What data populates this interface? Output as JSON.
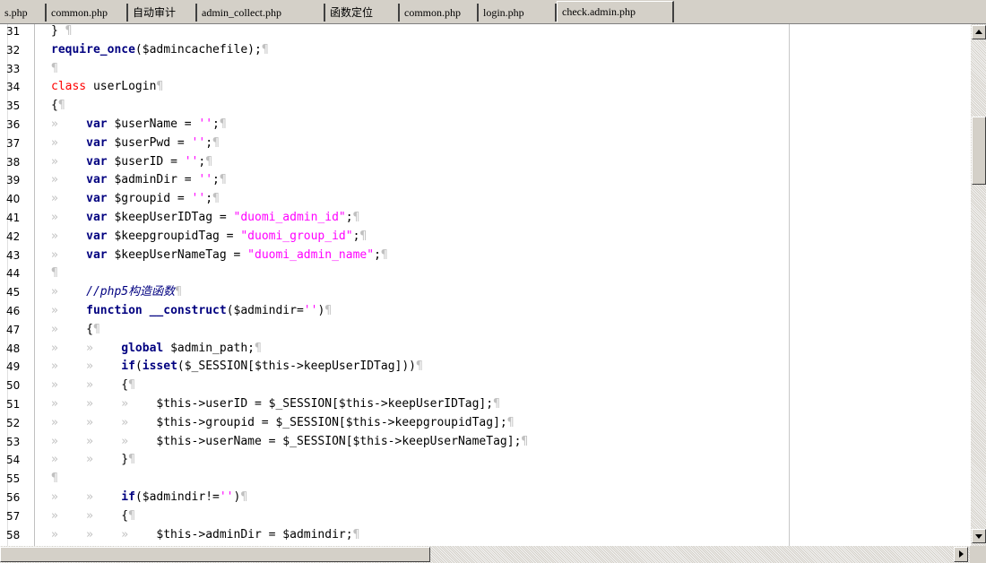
{
  "tabs": [
    {
      "label": "s.php",
      "active": false
    },
    {
      "label": "common.php",
      "active": false
    },
    {
      "label": "自动审计",
      "active": false
    },
    {
      "label": "admin_collect.php",
      "active": false
    },
    {
      "label": "函数定位",
      "active": false
    },
    {
      "label": "common.php",
      "active": false
    },
    {
      "label": "login.php",
      "active": false
    },
    {
      "label": "check.admin.php",
      "active": true
    }
  ],
  "editor": {
    "lines": [
      {
        "n": "31",
        "t": [
          [
            "p",
            "} "
          ],
          [
            "x",
            "¶"
          ]
        ]
      },
      {
        "n": "32",
        "t": [
          [
            "k",
            "require_once"
          ],
          [
            "p",
            "($admincachefile);"
          ],
          [
            "x",
            "¶"
          ]
        ]
      },
      {
        "n": "33",
        "t": [
          [
            "x",
            "¶"
          ]
        ]
      },
      {
        "n": "34",
        "t": [
          [
            "c",
            "class"
          ],
          [
            "p",
            " userLogin"
          ],
          [
            "x",
            "¶"
          ]
        ]
      },
      {
        "n": "35",
        "t": [
          [
            "p",
            "{"
          ],
          [
            "x",
            "¶"
          ]
        ]
      },
      {
        "n": "36",
        "t": [
          [
            "i",
            "»    "
          ],
          [
            "k",
            "var"
          ],
          [
            "p",
            " $userName = "
          ],
          [
            "s",
            "''"
          ],
          [
            "p",
            ";"
          ],
          [
            "x",
            "¶"
          ]
        ]
      },
      {
        "n": "37",
        "t": [
          [
            "i",
            "»    "
          ],
          [
            "k",
            "var"
          ],
          [
            "p",
            " $userPwd = "
          ],
          [
            "s",
            "''"
          ],
          [
            "p",
            ";"
          ],
          [
            "x",
            "¶"
          ]
        ]
      },
      {
        "n": "38",
        "t": [
          [
            "i",
            "»    "
          ],
          [
            "k",
            "var"
          ],
          [
            "p",
            " $userID = "
          ],
          [
            "s",
            "''"
          ],
          [
            "p",
            ";"
          ],
          [
            "x",
            "¶"
          ]
        ]
      },
      {
        "n": "39",
        "t": [
          [
            "i",
            "»    "
          ],
          [
            "k",
            "var"
          ],
          [
            "p",
            " $adminDir = "
          ],
          [
            "s",
            "''"
          ],
          [
            "p",
            ";"
          ],
          [
            "x",
            "¶"
          ]
        ]
      },
      {
        "n": "40",
        "t": [
          [
            "i",
            "»    "
          ],
          [
            "k",
            "var"
          ],
          [
            "p",
            " $groupid = "
          ],
          [
            "s",
            "''"
          ],
          [
            "p",
            ";"
          ],
          [
            "x",
            "¶"
          ]
        ]
      },
      {
        "n": "41",
        "t": [
          [
            "i",
            "»    "
          ],
          [
            "k",
            "var"
          ],
          [
            "p",
            " $keepUserIDTag = "
          ],
          [
            "s",
            "\"duomi_admin_id\""
          ],
          [
            "p",
            ";"
          ],
          [
            "x",
            "¶"
          ]
        ]
      },
      {
        "n": "42",
        "t": [
          [
            "i",
            "»    "
          ],
          [
            "k",
            "var"
          ],
          [
            "p",
            " $keepgroupidTag = "
          ],
          [
            "s",
            "\"duomi_group_id\""
          ],
          [
            "p",
            ";"
          ],
          [
            "x",
            "¶"
          ]
        ]
      },
      {
        "n": "43",
        "t": [
          [
            "i",
            "»    "
          ],
          [
            "k",
            "var"
          ],
          [
            "p",
            " $keepUserNameTag = "
          ],
          [
            "s",
            "\"duomi_admin_name\""
          ],
          [
            "p",
            ";"
          ],
          [
            "x",
            "¶"
          ]
        ]
      },
      {
        "n": "44",
        "t": [
          [
            "x",
            "¶"
          ]
        ]
      },
      {
        "n": "45",
        "t": [
          [
            "i",
            "»    "
          ],
          [
            "m",
            "//php5构造函数"
          ],
          [
            "x",
            "¶"
          ]
        ]
      },
      {
        "n": "46",
        "t": [
          [
            "i",
            "»    "
          ],
          [
            "k",
            "function"
          ],
          [
            "p",
            " "
          ],
          [
            "k",
            "__construct"
          ],
          [
            "p",
            "($admindir="
          ],
          [
            "s",
            "''"
          ],
          [
            "p",
            ")"
          ],
          [
            "x",
            "¶"
          ]
        ]
      },
      {
        "n": "47",
        "t": [
          [
            "i",
            "»    "
          ],
          [
            "p",
            "{"
          ],
          [
            "x",
            "¶"
          ]
        ]
      },
      {
        "n": "48",
        "t": [
          [
            "i",
            "»    »    "
          ],
          [
            "k",
            "global"
          ],
          [
            "p",
            " $admin_path;"
          ],
          [
            "x",
            "¶"
          ]
        ]
      },
      {
        "n": "49",
        "t": [
          [
            "i",
            "»    »    "
          ],
          [
            "k",
            "if"
          ],
          [
            "p",
            "("
          ],
          [
            "k",
            "isset"
          ],
          [
            "p",
            "($_SESSION[$this->keepUserIDTag]))"
          ],
          [
            "x",
            "¶"
          ]
        ]
      },
      {
        "n": "50",
        "t": [
          [
            "i",
            "»    »    "
          ],
          [
            "p",
            "{"
          ],
          [
            "x",
            "¶"
          ]
        ]
      },
      {
        "n": "51",
        "t": [
          [
            "i",
            "»    »    »    "
          ],
          [
            "p",
            "$this->userID = $_SESSION[$this->keepUserIDTag];"
          ],
          [
            "x",
            "¶"
          ]
        ]
      },
      {
        "n": "52",
        "t": [
          [
            "i",
            "»    »    »    "
          ],
          [
            "p",
            "$this->groupid = $_SESSION[$this->keepgroupidTag];"
          ],
          [
            "x",
            "¶"
          ]
        ]
      },
      {
        "n": "53",
        "t": [
          [
            "i",
            "»    »    »    "
          ],
          [
            "p",
            "$this->userName = $_SESSION[$this->keepUserNameTag];"
          ],
          [
            "x",
            "¶"
          ]
        ]
      },
      {
        "n": "54",
        "t": [
          [
            "i",
            "»    »    "
          ],
          [
            "p",
            "}"
          ],
          [
            "x",
            "¶"
          ]
        ]
      },
      {
        "n": "55",
        "t": [
          [
            "x",
            "¶"
          ]
        ]
      },
      {
        "n": "56",
        "t": [
          [
            "i",
            "»    »    "
          ],
          [
            "k",
            "if"
          ],
          [
            "p",
            "($admindir!="
          ],
          [
            "s",
            "''"
          ],
          [
            "p",
            ")"
          ],
          [
            "x",
            "¶"
          ]
        ]
      },
      {
        "n": "57",
        "t": [
          [
            "i",
            "»    »    "
          ],
          [
            "p",
            "{"
          ],
          [
            "x",
            "¶"
          ]
        ]
      },
      {
        "n": "58",
        "t": [
          [
            "i",
            "»    »    »    "
          ],
          [
            "p",
            "$this->adminDir = $admindir;"
          ],
          [
            "x",
            "¶"
          ]
        ]
      }
    ]
  },
  "icons": {
    "scroll_up": "triangle-up",
    "scroll_down": "triangle-down",
    "scroll_right": "triangle-right"
  }
}
